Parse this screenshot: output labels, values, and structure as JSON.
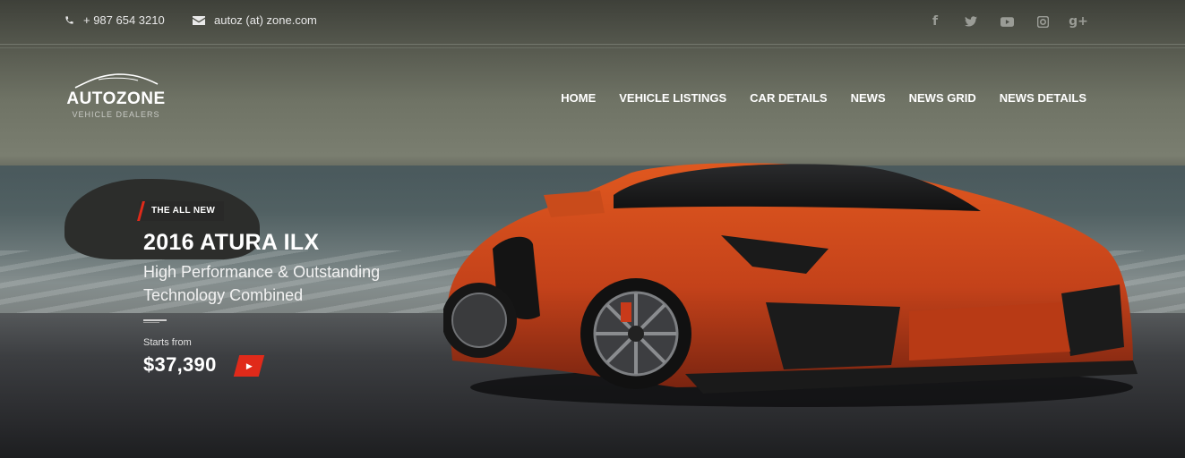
{
  "topbar": {
    "phone": "+ 987 654 3210",
    "email": "autoz (at) zone.com",
    "socials": [
      {
        "icon": "facebook-icon",
        "glyph": "f"
      },
      {
        "icon": "twitter-icon",
        "glyph": "t"
      },
      {
        "icon": "youtube-icon",
        "glyph": "▶"
      },
      {
        "icon": "instagram-icon",
        "glyph": "◎"
      },
      {
        "icon": "google-plus-icon",
        "glyph": "g+"
      }
    ]
  },
  "logo": {
    "name": "AUTOZONE",
    "tagline": "VEHICLE DEALERS"
  },
  "nav": {
    "items": [
      "HOME",
      "VEHICLE LISTINGS",
      "CAR DETAILS",
      "NEWS",
      "NEWS GRID",
      "NEWS DETAILS"
    ]
  },
  "hero": {
    "badge": "THE ALL NEW",
    "title": "2016 ATURA ILX",
    "subtitle": "High Performance & Outstanding Technology Combined",
    "starts_label": "Starts from",
    "price": "$37,390"
  },
  "colors": {
    "accent": "#e02a1a",
    "car": "#c9471a"
  }
}
